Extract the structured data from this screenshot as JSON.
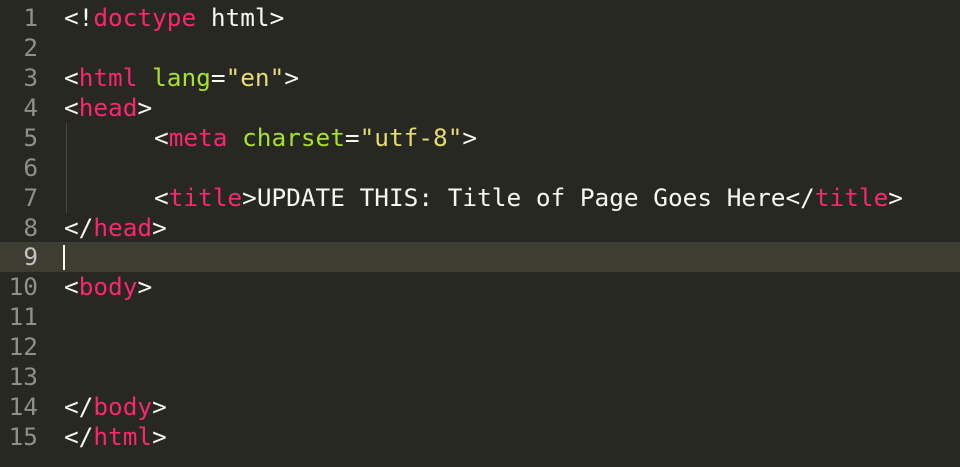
{
  "editor": {
    "theme_colors": {
      "background": "#272822",
      "active_line": "#3E3D32",
      "gutter_text": "#8F908A",
      "tag": "#F92672",
      "attribute": "#A6E22E",
      "string": "#E6DB74",
      "text": "#F8F8F2"
    },
    "active_line_number": 9,
    "lines": [
      {
        "number": "1",
        "tokens": [
          "<!",
          "doctype",
          " html>"
        ]
      },
      {
        "number": "2",
        "tokens": []
      },
      {
        "number": "3",
        "tokens": [
          "<",
          "html",
          " ",
          "lang",
          "=",
          "\"en\"",
          ">"
        ]
      },
      {
        "number": "4",
        "tokens": [
          "<",
          "head",
          ">"
        ]
      },
      {
        "number": "5",
        "tokens": [
          "<",
          "meta",
          " ",
          "charset",
          "=",
          "\"utf-8\"",
          ">"
        ]
      },
      {
        "number": "6",
        "tokens": []
      },
      {
        "number": "7",
        "tokens": [
          "<",
          "title",
          ">",
          "UPDATE THIS: Title of Page Goes Here",
          "</",
          "title",
          ">"
        ]
      },
      {
        "number": "8",
        "tokens": [
          "</",
          "head",
          ">"
        ]
      },
      {
        "number": "9",
        "tokens": []
      },
      {
        "number": "10",
        "tokens": [
          "<",
          "body",
          ">"
        ]
      },
      {
        "number": "11",
        "tokens": []
      },
      {
        "number": "12",
        "tokens": []
      },
      {
        "number": "13",
        "tokens": []
      },
      {
        "number": "14",
        "tokens": [
          "</",
          "body",
          ">"
        ]
      },
      {
        "number": "15",
        "tokens": [
          "</",
          "html",
          ">"
        ]
      }
    ]
  }
}
